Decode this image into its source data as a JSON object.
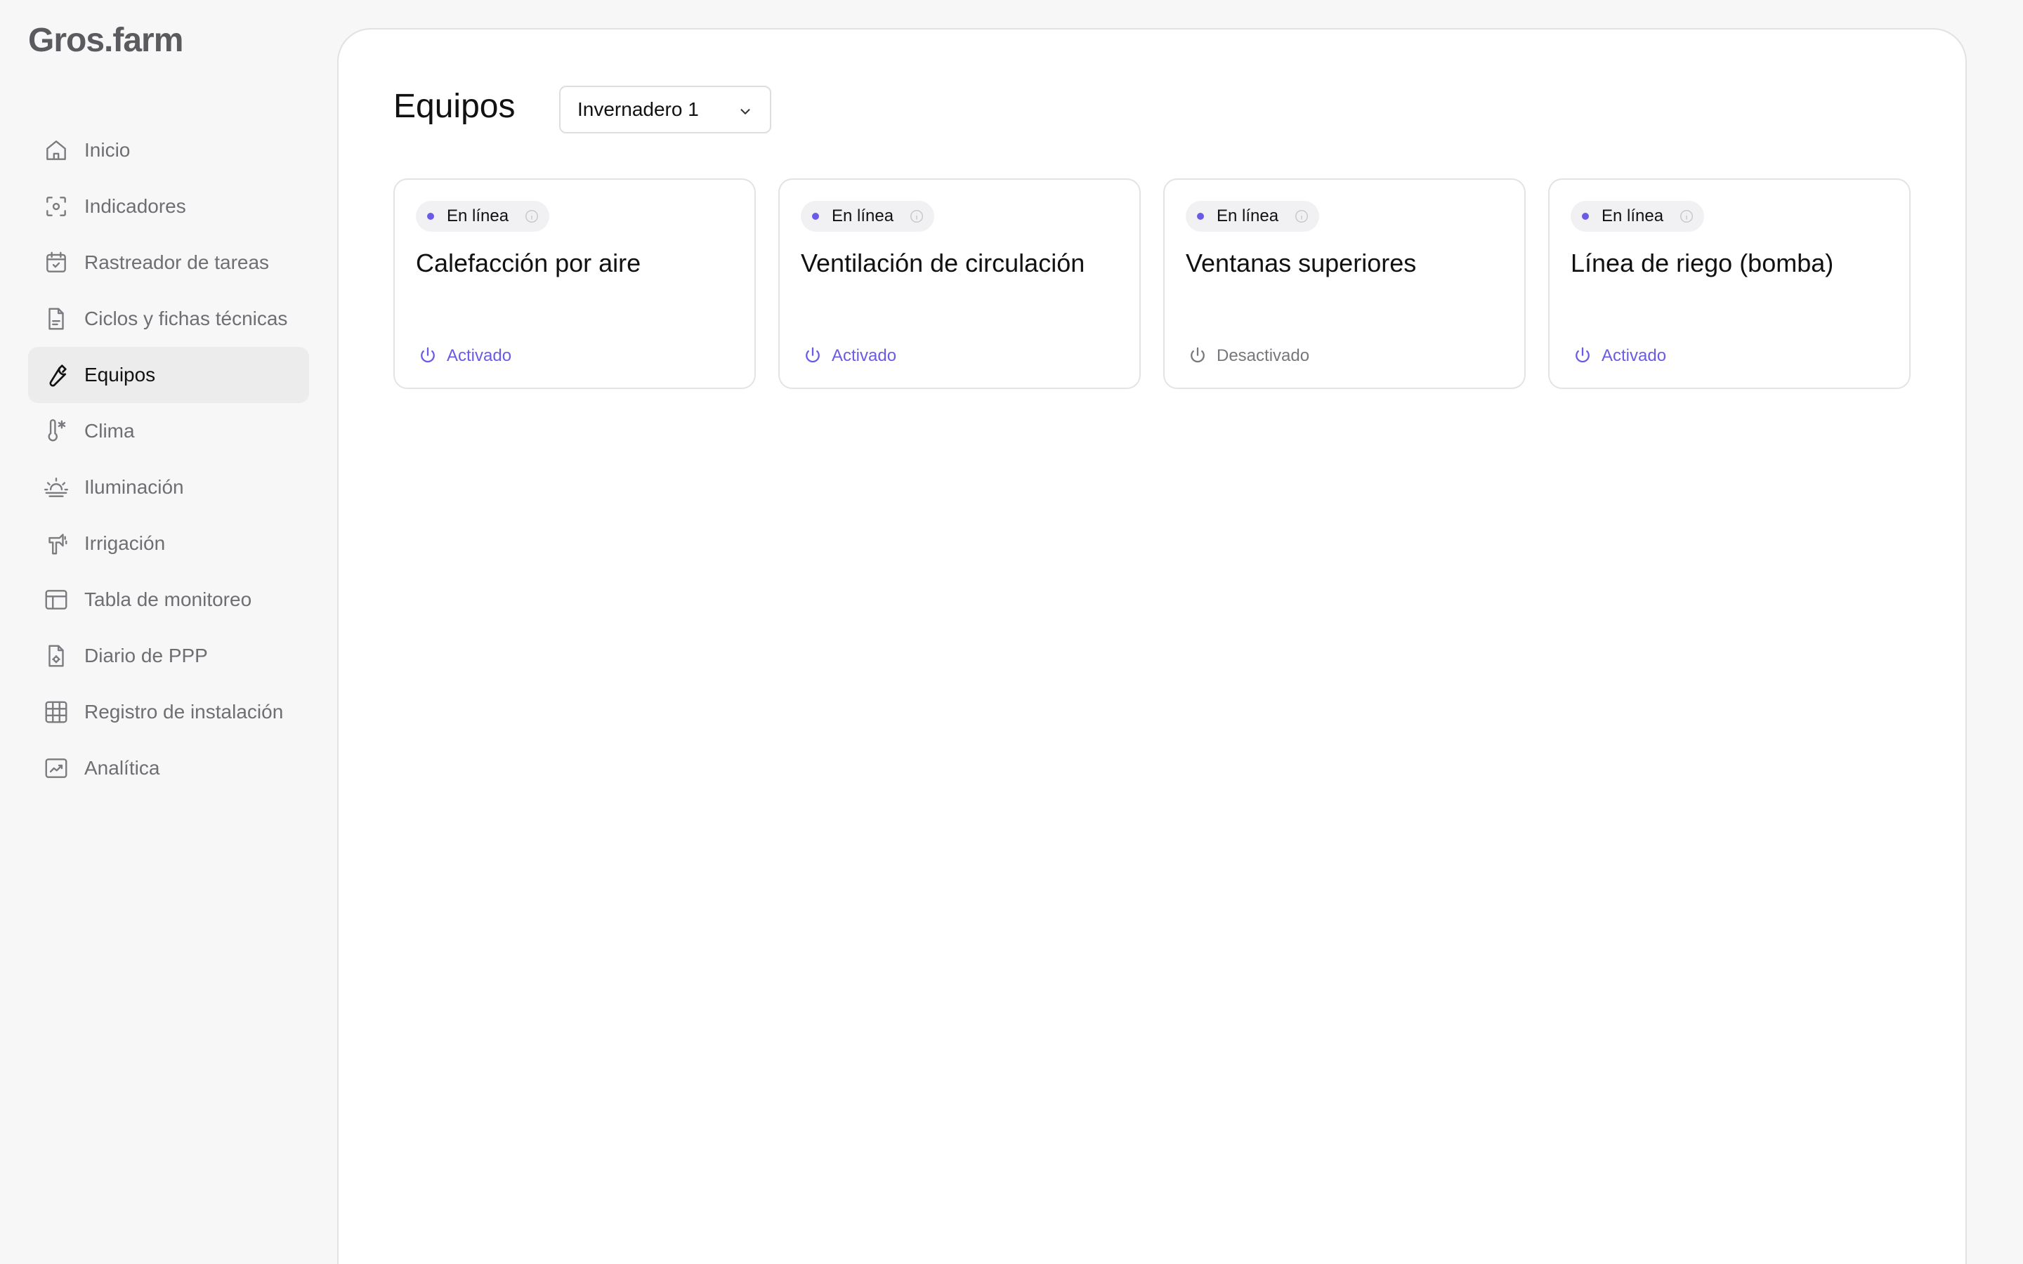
{
  "brand": {
    "logo_text": "Gros.farm"
  },
  "sidebar": {
    "items": [
      {
        "label": "Inicio",
        "icon": "home-icon",
        "active": false
      },
      {
        "label": "Indicadores",
        "icon": "sensor-icon",
        "active": false
      },
      {
        "label": "Rastreador de tareas",
        "icon": "calendar-check-icon",
        "active": false
      },
      {
        "label": "Ciclos y fichas técnicas",
        "icon": "document-icon",
        "active": false
      },
      {
        "label": "Equipos",
        "icon": "wrench-icon",
        "active": true
      },
      {
        "label": "Clima",
        "icon": "thermometer-icon",
        "active": false
      },
      {
        "label": "Iluminación",
        "icon": "sunrise-icon",
        "active": false
      },
      {
        "label": "Irrigación",
        "icon": "sprinkler-icon",
        "active": false
      },
      {
        "label": "Tabla de monitoreo",
        "icon": "table-icon",
        "active": false
      },
      {
        "label": "Diario de PPP",
        "icon": "file-gear-icon",
        "active": false
      },
      {
        "label": "Registro de instalación",
        "icon": "grid-icon",
        "active": false
      },
      {
        "label": "Analítica",
        "icon": "chart-icon",
        "active": false
      }
    ]
  },
  "main": {
    "title": "Equipos",
    "greenhouse_select": {
      "value": "Invernadero 1"
    },
    "cards": [
      {
        "status": "En línea",
        "name": "Calefacción por aire",
        "power": "Activado",
        "on": true
      },
      {
        "status": "En línea",
        "name": "Ventilación de circulación",
        "power": "Activado",
        "on": true
      },
      {
        "status": "En línea",
        "name": "Ventanas superiores",
        "power": "Desactivado",
        "on": false
      },
      {
        "status": "En línea",
        "name": "Línea de riego (bomba)",
        "power": "Activado",
        "on": true
      }
    ]
  },
  "colors": {
    "accent": "#6a5be6",
    "inactive_text": "#77777c",
    "active_nav_bg": "#ececec"
  }
}
